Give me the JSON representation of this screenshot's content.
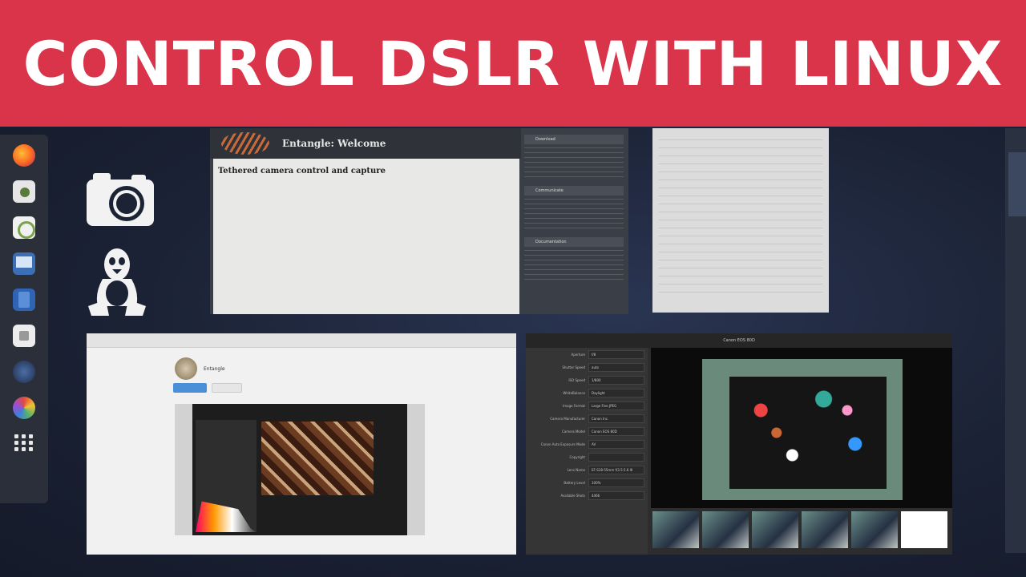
{
  "banner": {
    "title": "CONTROL DSLR WITH LINUX"
  },
  "dock": {
    "items": [
      "firefox-icon",
      "software-icon",
      "tweaks-icon",
      "remote-desktop-icon",
      "notes-icon",
      "clipboard-icon",
      "entangle-icon",
      "darktable-icon",
      "apps-grid-icon"
    ]
  },
  "entangle_page": {
    "header": "Entangle: Welcome",
    "heading": "Tethered camera control and capture",
    "side_download": "Download",
    "side_community": "Communicate",
    "side_documentation": "Documentation"
  },
  "software_window": {
    "title": "Entangle"
  },
  "camera_window": {
    "title": "Canon EOS 80D",
    "settings": [
      {
        "label": "Aperture",
        "value": "f/8"
      },
      {
        "label": "Shutter Speed",
        "value": "auto"
      },
      {
        "label": "ISO Speed",
        "value": "1/800"
      },
      {
        "label": "WhiteBalance",
        "value": "Daylight"
      },
      {
        "label": "Image Format",
        "value": "Large Fine JPEG"
      },
      {
        "label": "Camera Manufacturer",
        "value": "Canon Inc."
      },
      {
        "label": "Camera Model",
        "value": "Canon EOS 80D"
      },
      {
        "label": "Canon Auto Exposure Mode",
        "value": "AV"
      },
      {
        "label": "Copyright",
        "value": ""
      },
      {
        "label": "Lens Name",
        "value": "EF-S18-55mm f/3.5-5.6 III"
      },
      {
        "label": "Battery Level",
        "value": "100%"
      },
      {
        "label": "Available Shots",
        "value": "4466"
      }
    ]
  }
}
